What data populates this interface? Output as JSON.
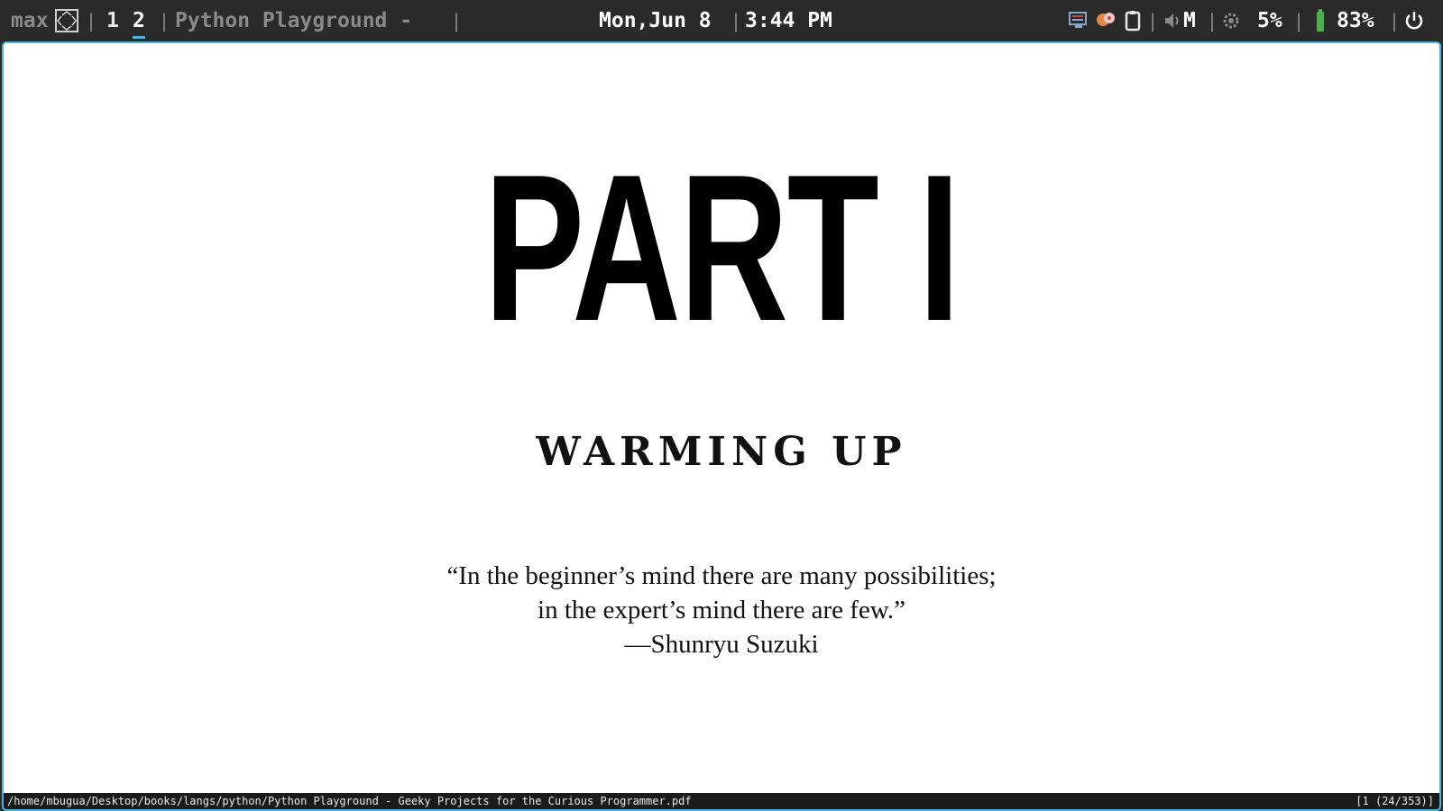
{
  "topbar": {
    "layout_label": "max",
    "workspaces": [
      "1",
      "2"
    ],
    "active_workspace": "2",
    "window_title": "Python Playground -",
    "date": "Mon,Jun 8",
    "time": "3:44 PM",
    "volume_label": "M",
    "cpu": "5%",
    "battery": "83%"
  },
  "document": {
    "part": "PART I",
    "subtitle": "WARMING UP",
    "quote_line1": "“In the beginner’s mind there are many possibilities;",
    "quote_line2": "in the expert’s mind there are few.”",
    "attribution": "—Shunryu Suzuki"
  },
  "statusbar": {
    "path": "/home/mbugua/Desktop/books/langs/python/Python Playground - Geeky Projects for the Curious Programmer.pdf",
    "page": "[1 (24/353)]"
  },
  "colors": {
    "accent": "#4fb3d9",
    "bar_bg": "#2a2a2a",
    "battery": "#4caf50"
  }
}
